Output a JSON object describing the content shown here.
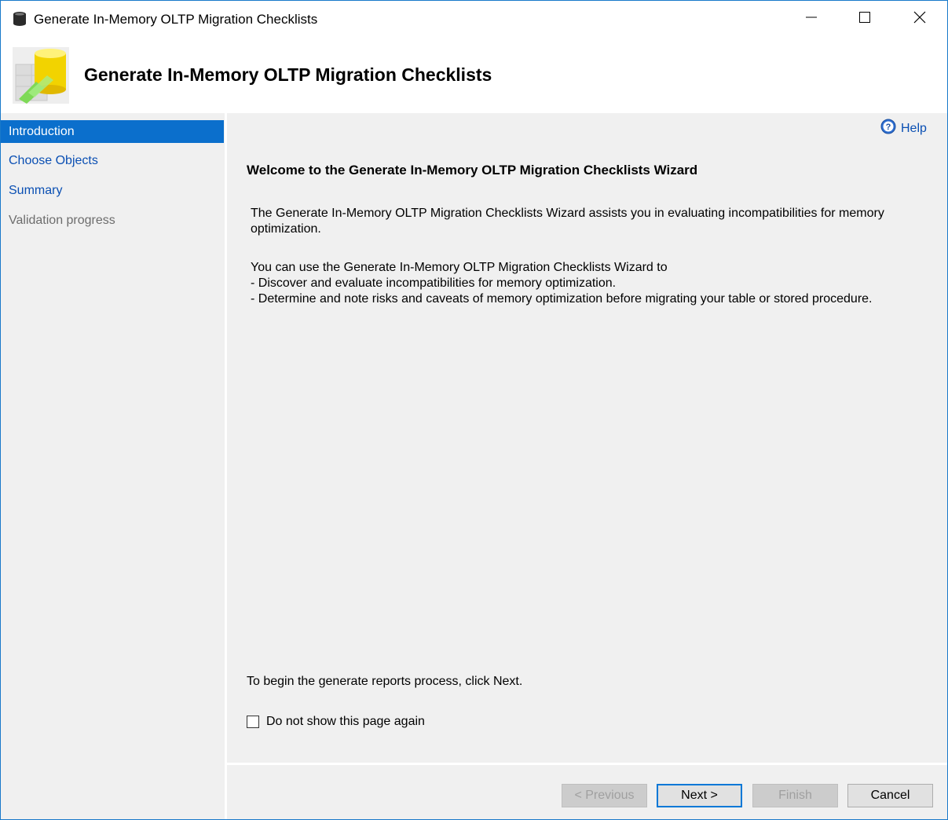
{
  "window": {
    "title": "Generate In-Memory OLTP Migration Checklists",
    "icons": {
      "app": "database-icon",
      "minimize": "minimize-icon",
      "maximize": "maximize-icon",
      "close": "close-icon"
    }
  },
  "header": {
    "title": "Generate In-Memory OLTP Migration Checklists",
    "logo": "database-wizard-logo"
  },
  "nav": {
    "items": [
      {
        "label": "Introduction",
        "state": "active"
      },
      {
        "label": "Choose Objects",
        "state": "link"
      },
      {
        "label": "Summary",
        "state": "link"
      },
      {
        "label": "Validation progress",
        "state": "disabled"
      }
    ]
  },
  "main": {
    "help_label": "Help",
    "heading": "Welcome to the Generate In-Memory OLTP Migration Checklists Wizard",
    "paragraph1": "The Generate In-Memory OLTP Migration Checklists Wizard assists you in evaluating incompatibilities for memory optimization.",
    "paragraph2_lines": [
      "You can use the Generate In-Memory OLTP Migration Checklists Wizard to",
      "- Discover and evaluate incompatibilities for memory optimization.",
      "- Determine and note risks and caveats of memory optimization before migrating your table or stored procedure."
    ],
    "footer_text": "To begin the generate reports process, click Next.",
    "checkbox_label": "Do not show this page again",
    "checkbox_checked": false
  },
  "buttons": {
    "previous": "< Previous",
    "next": "Next >",
    "finish": "Finish",
    "cancel": "Cancel"
  },
  "colors": {
    "accent": "#0b6fcc",
    "link": "#0a4fb3",
    "border": "#1979ca"
  }
}
